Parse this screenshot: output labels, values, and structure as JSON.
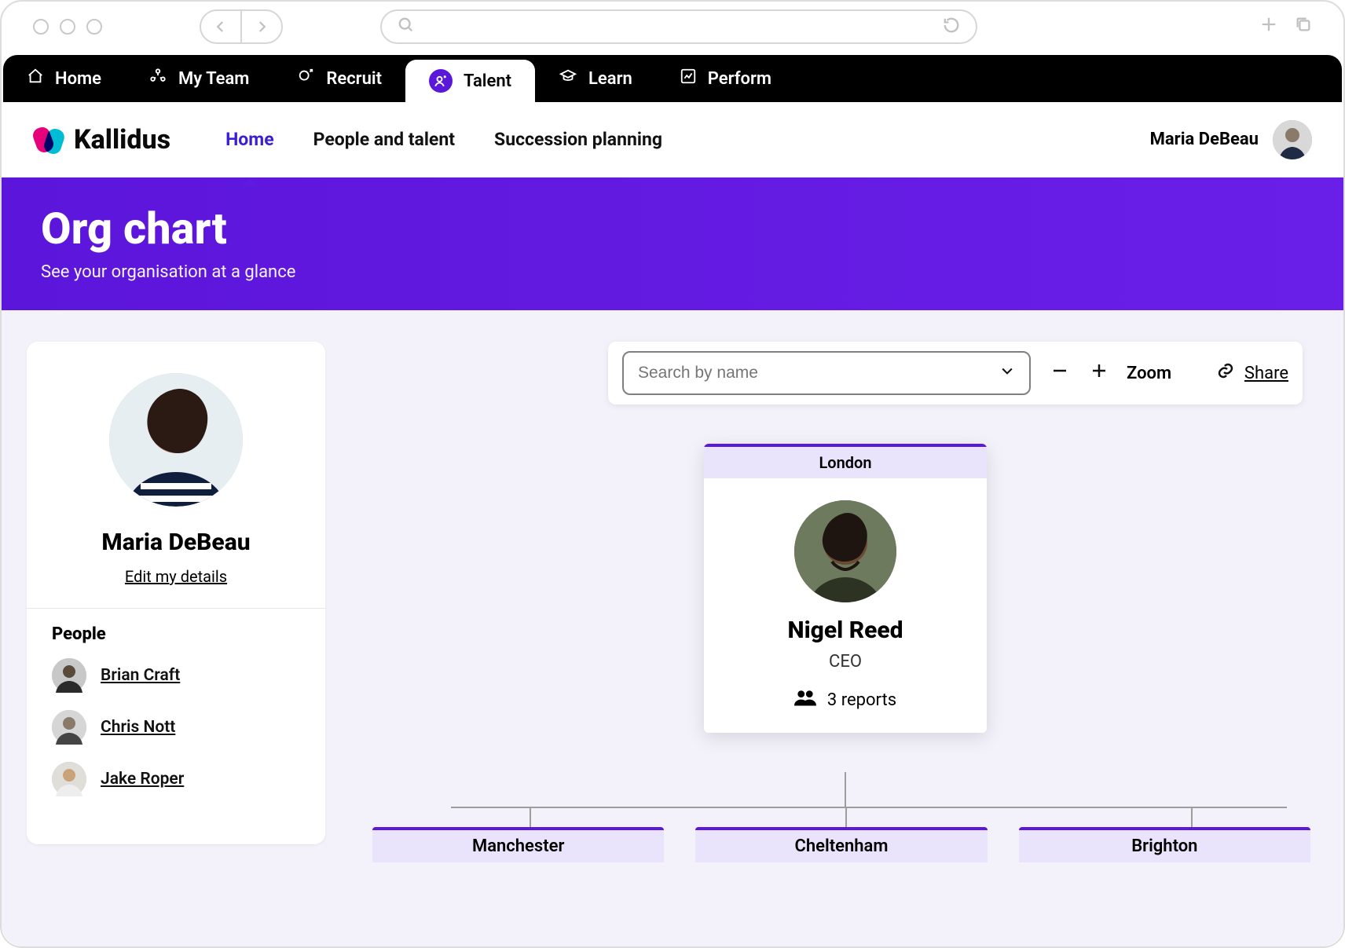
{
  "chrome": {
    "back_aria": "Back",
    "forward_aria": "Forward",
    "newtab_aria": "New tab",
    "windows_aria": "Windows"
  },
  "primary_nav": {
    "items": [
      {
        "label": "Home",
        "icon": "home-icon"
      },
      {
        "label": "My Team",
        "icon": "team-icon"
      },
      {
        "label": "Recruit",
        "icon": "recruit-icon"
      },
      {
        "label": "Talent",
        "icon": "talent-icon"
      },
      {
        "label": "Learn",
        "icon": "learn-icon"
      },
      {
        "label": "Perform",
        "icon": "perform-icon"
      }
    ],
    "active_index": 3
  },
  "brand": {
    "name": "Kallidus"
  },
  "sub_tabs": {
    "items": [
      {
        "label": "Home"
      },
      {
        "label": "People and talent"
      },
      {
        "label": "Succession planning"
      }
    ],
    "active_index": 0
  },
  "current_user": {
    "name": "Maria DeBeau"
  },
  "banner": {
    "title": "Org chart",
    "subtitle": "See your organisation at a glance"
  },
  "profile": {
    "name": "Maria DeBeau",
    "edit_label": "Edit my details",
    "people_heading": "People",
    "people": [
      {
        "name": "Brian Craft"
      },
      {
        "name": "Chris Nott"
      },
      {
        "name": "Jake Roper"
      }
    ]
  },
  "toolbar": {
    "search_placeholder": "Search by name",
    "zoom_label": "Zoom",
    "share_label": "Share"
  },
  "org": {
    "root": {
      "location": "London",
      "name": "Nigel Reed",
      "title": "CEO",
      "reports_label": "3 reports",
      "reports_count": 3
    },
    "child_locations": [
      {
        "label": "Manchester"
      },
      {
        "label": "Cheltenham"
      },
      {
        "label": "Brighton"
      }
    ]
  },
  "colors": {
    "accent": "#5a18d8",
    "accent_light": "#e9e3fc",
    "surface": "#f3f1f9"
  }
}
